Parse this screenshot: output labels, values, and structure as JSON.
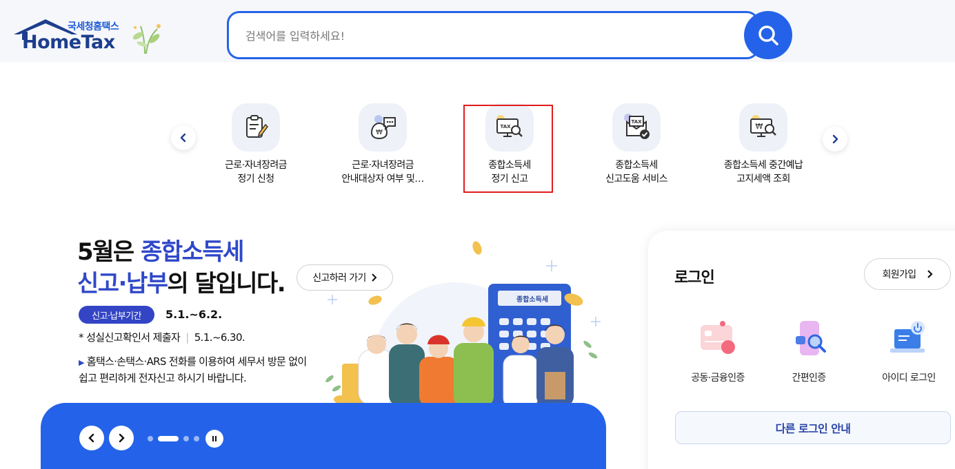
{
  "header": {
    "logo_sub": "국세청홈택스",
    "logo_main": "HomeTax",
    "search_placeholder": "검색어를 입력하세요!",
    "search_icon": "search-icon"
  },
  "quick_menu": {
    "items": [
      {
        "line1": "근로·자녀장려금",
        "line2": "정기 신청",
        "icon": "clipboard-edit-icon"
      },
      {
        "line1": "근로·자녀장려금",
        "line2": "안내대상자 여부 및…",
        "icon": "money-chat-icon"
      },
      {
        "line1": "종합소득세",
        "line2": "정기 신고",
        "icon": "tax-monitor-search-icon"
      },
      {
        "line1": "종합소득세",
        "line2": "신고도움 서비스",
        "icon": "tax-document-check-icon"
      },
      {
        "line1": "종합소득세 중간예납",
        "line2": "고지세액 조회",
        "icon": "won-monitor-search-icon"
      }
    ]
  },
  "banner": {
    "title1_prefix": "5월은 ",
    "title1_blue": "종합소득세",
    "title2_blue": "신고·납부",
    "title2_suffix": "의 달입니다.",
    "cta": "신고하러 가기",
    "period_badge": "신고·납부기간",
    "period_date": "5.1.~6.2.",
    "line2_label": "성실신고확인서 제출자",
    "line2_date": "5.1.~6.30.",
    "line3a": "홈택스·손택스·ARS 전화를 이용하여 세무서 방문 없이",
    "line3b": "쉽고 편리하게 전자신고 하시기 바랍니다.",
    "calc_label": "종합소득세",
    "slide_count": 4,
    "active_slide": 2
  },
  "login": {
    "title": "로그인",
    "join": "회원가입",
    "options": [
      {
        "label": "공동·금융인증",
        "icon": "certificate-card-icon"
      },
      {
        "label": "간편인증",
        "icon": "phone-search-icon"
      },
      {
        "label": "아이디 로그인",
        "icon": "laptop-power-icon"
      }
    ],
    "other": "다른 로그인 안내"
  },
  "colors": {
    "primary": "#2463e9",
    "navy": "#1d3e8e",
    "accent_blue": "#2f48c9",
    "highlight": "#e01b1b"
  }
}
